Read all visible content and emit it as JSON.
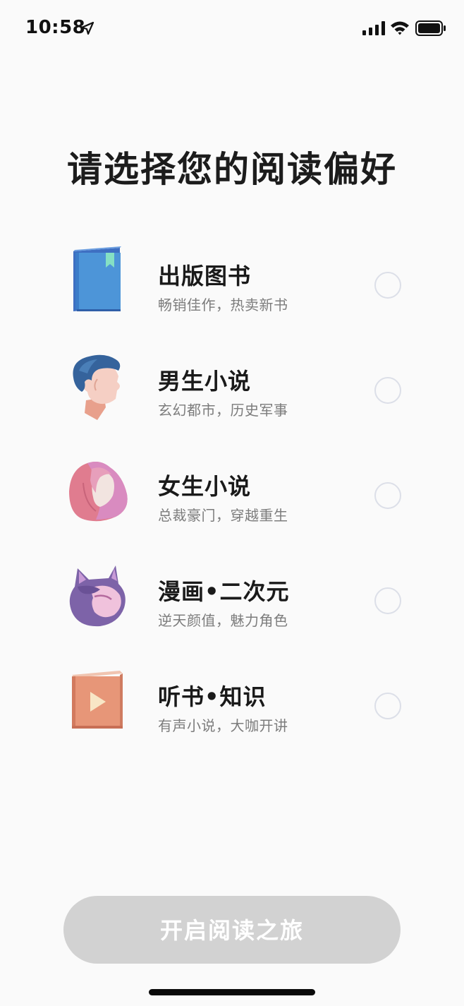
{
  "status_bar": {
    "time": "10:58",
    "icons": [
      "location-arrow-icon",
      "cellular-signal-icon",
      "wifi-icon",
      "battery-icon"
    ]
  },
  "page": {
    "title": "请选择您的阅读偏好"
  },
  "options": [
    {
      "title": "出版图书",
      "subtitle": "畅销佳作，热卖新书",
      "icon": "book-icon",
      "selected": false
    },
    {
      "title": "男生小说",
      "subtitle": "玄幻都市，历史军事",
      "icon": "male-avatar-icon",
      "selected": false
    },
    {
      "title": "女生小说",
      "subtitle": "总裁豪门，穿越重生",
      "icon": "female-avatar-icon",
      "selected": false
    },
    {
      "title": "漫画•二次元",
      "subtitle": "逆天颜值，魅力角色",
      "icon": "anime-cat-icon",
      "selected": false
    },
    {
      "title": "听书•知识",
      "subtitle": "有声小说，大咖开讲",
      "icon": "audiobook-icon",
      "selected": false
    }
  ],
  "start_button": {
    "label": "开启阅读之旅",
    "enabled": false
  },
  "colors": {
    "background": "#fafafa",
    "button_disabled": "#d2d2d2",
    "radio_border": "#dcdfe8",
    "subtitle_text": "#7c7c7c"
  }
}
